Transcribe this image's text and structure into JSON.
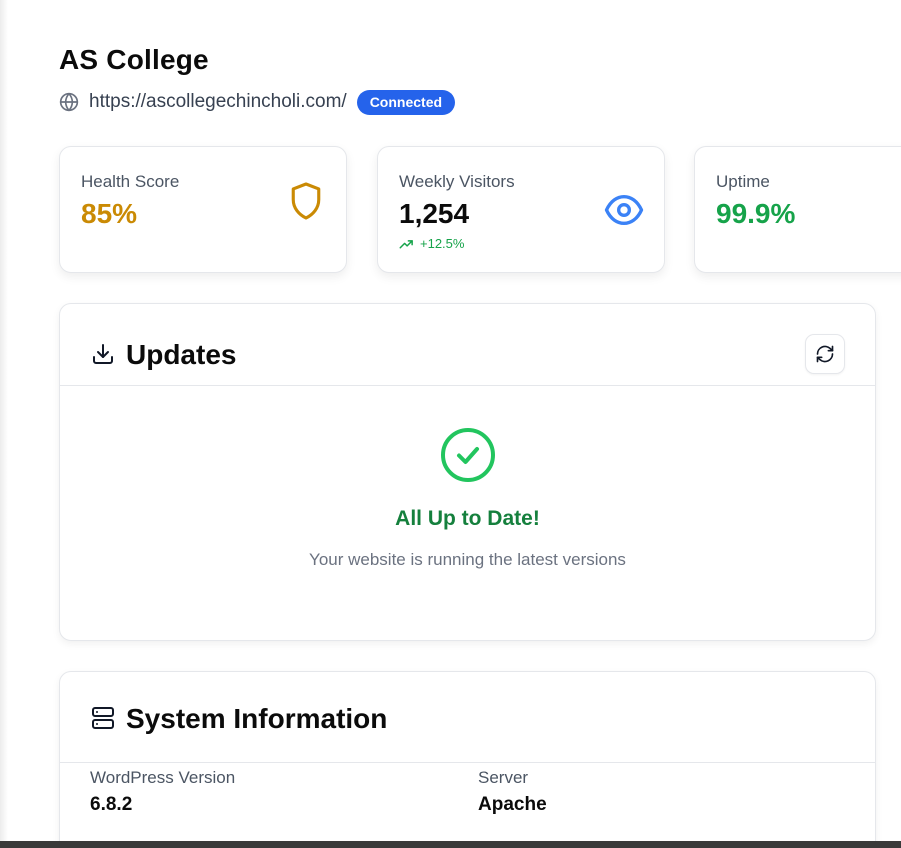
{
  "site": {
    "title": "AS College",
    "url": "https://ascollegechincholi.com/",
    "status": "Connected"
  },
  "stats": [
    {
      "label": "Health Score",
      "value": "85%",
      "icon": "shield-icon",
      "color": "#ca8a04"
    },
    {
      "label": "Weekly Visitors",
      "value": "1,254",
      "trend": "+12.5%",
      "icon": "eye-icon",
      "color": "#111827"
    },
    {
      "label": "Uptime",
      "value": "99.9%",
      "color": "#16a34a"
    }
  ],
  "updates": {
    "title": "Updates",
    "status_title": "All Up to Date!",
    "status_subtitle": "Your website is running the latest versions"
  },
  "system_info": {
    "title": "System Information",
    "items": [
      {
        "label": "WordPress Version",
        "value": "6.8.2"
      },
      {
        "label": "Server",
        "value": "Apache"
      }
    ]
  },
  "colors": {
    "accent": "#2563eb",
    "success": "#22c55e",
    "warning": "#ca8a04"
  }
}
